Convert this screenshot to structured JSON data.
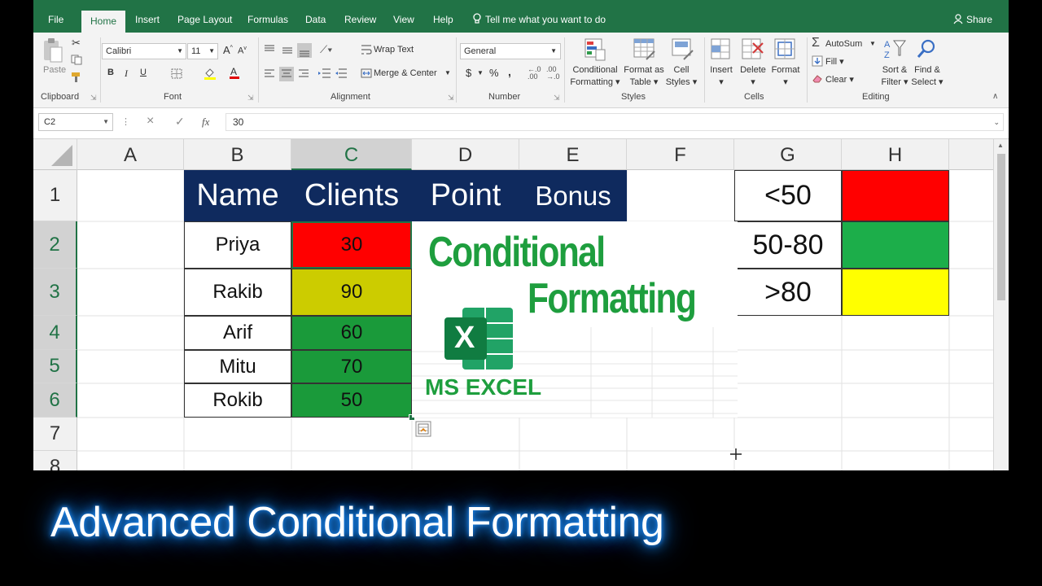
{
  "tabs": [
    "File",
    "Home",
    "Insert",
    "Page Layout",
    "Formulas",
    "Data",
    "Review",
    "View",
    "Help"
  ],
  "tell_me": "Tell me what you want to do",
  "share": "Share",
  "ribbon": {
    "clipboard": {
      "label": "Clipboard",
      "paste": "Paste"
    },
    "font": {
      "label": "Font",
      "name": "Calibri",
      "size": "11",
      "bold": "B",
      "italic": "I",
      "underline": "U",
      "grow": "A",
      "shrink": "A"
    },
    "alignment": {
      "label": "Alignment",
      "wrap": "Wrap Text",
      "merge": "Merge & Center"
    },
    "number": {
      "label": "Number",
      "format": "General",
      "currency": "$",
      "percent": "%",
      "comma": ","
    },
    "styles": {
      "label": "Styles",
      "conditional": "Conditional",
      "conditional2": "Formatting",
      "format_table": "Format as",
      "format_table2": "Table",
      "cell_styles": "Cell",
      "cell_styles2": "Styles"
    },
    "cells": {
      "label": "Cells",
      "insert": "Insert",
      "delete": "Delete",
      "format": "Format"
    },
    "editing": {
      "label": "Editing",
      "autosum": "AutoSum",
      "fill": "Fill",
      "clear": "Clear",
      "sort": "Sort &",
      "sort2": "Filter",
      "find": "Find &",
      "find2": "Select"
    }
  },
  "formula_bar": {
    "name_box": "C2",
    "cancel": "×",
    "enter": "✓",
    "fx": "fx",
    "value": "30"
  },
  "columns": [
    "A",
    "B",
    "C",
    "D",
    "E",
    "F",
    "G",
    "H"
  ],
  "rows": [
    "1",
    "2",
    "3",
    "4",
    "5",
    "6",
    "7",
    "8"
  ],
  "table_headers": [
    "Name",
    "Clients",
    "Point",
    "Bonus"
  ],
  "data_rows": [
    {
      "name": "Priya",
      "point": "30",
      "color": "#ff0000"
    },
    {
      "name": "Rakib",
      "point": "90",
      "color": "#cccc00"
    },
    {
      "name": "Arif",
      "point": "60",
      "color": "#1a9a3a"
    },
    {
      "name": "Mitu",
      "point": "70",
      "color": "#1a9a3a"
    },
    {
      "name": "Rokib",
      "point": "50",
      "color": "#1a9a3a"
    }
  ],
  "legend": [
    {
      "label": "<50",
      "color": "#ff0000"
    },
    {
      "label": "50-80",
      "color": "#1cae4a"
    },
    {
      "label": ">80",
      "color": "#ffff00"
    }
  ],
  "overlay": {
    "line1": "Conditional",
    "line2": "Formatting",
    "logo_letter": "X",
    "logo_text": "MS EXCEL",
    "color": "#1e9e3e"
  },
  "footer_title": "Advanced Conditional Formatting"
}
